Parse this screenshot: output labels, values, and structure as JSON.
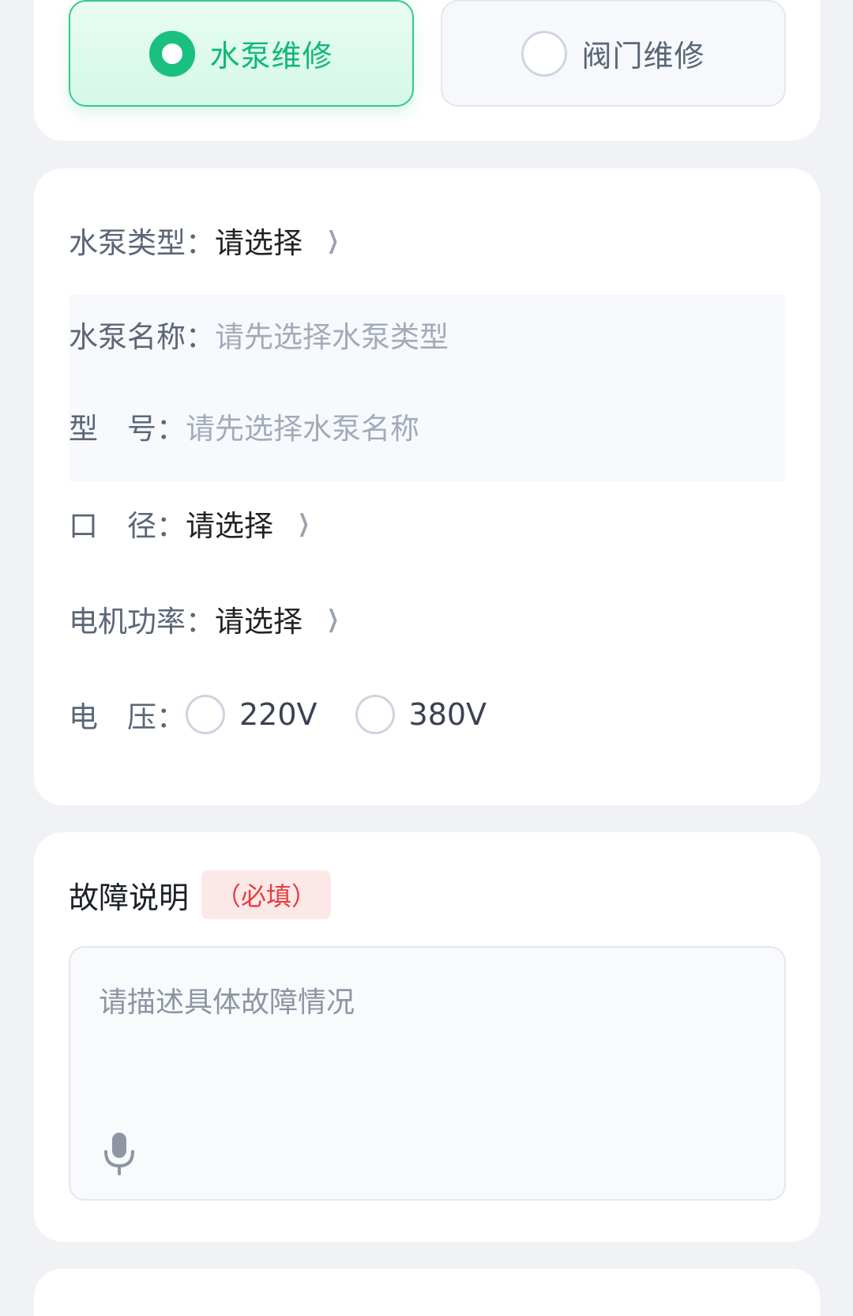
{
  "repair_type": {
    "options": [
      {
        "label": "水泵维修",
        "selected": true
      },
      {
        "label": "阀门维修",
        "selected": false
      }
    ]
  },
  "form": {
    "pump_type": {
      "label": "水泵类型：",
      "value": "请选择"
    },
    "pump_name": {
      "label": "水泵名称：",
      "placeholder": "请先选择水泵类型"
    },
    "model": {
      "label": "型　号：",
      "placeholder": "请先选择水泵名称"
    },
    "caliber": {
      "label": "口　径：",
      "value": "请选择"
    },
    "motor_power": {
      "label": "电机功率：",
      "value": "请选择"
    },
    "voltage": {
      "label": "电　压：",
      "options": [
        "220V",
        "380V"
      ]
    }
  },
  "fault": {
    "title": "故障说明",
    "required": "（必填）",
    "placeholder": "请描述具体故障情况"
  },
  "icons": {
    "chevron": "chevron-right-icon",
    "mic": "microphone-icon"
  },
  "colors": {
    "accent": "#19c07f",
    "required": "#e53e3e",
    "background": "#f1f2f5"
  }
}
